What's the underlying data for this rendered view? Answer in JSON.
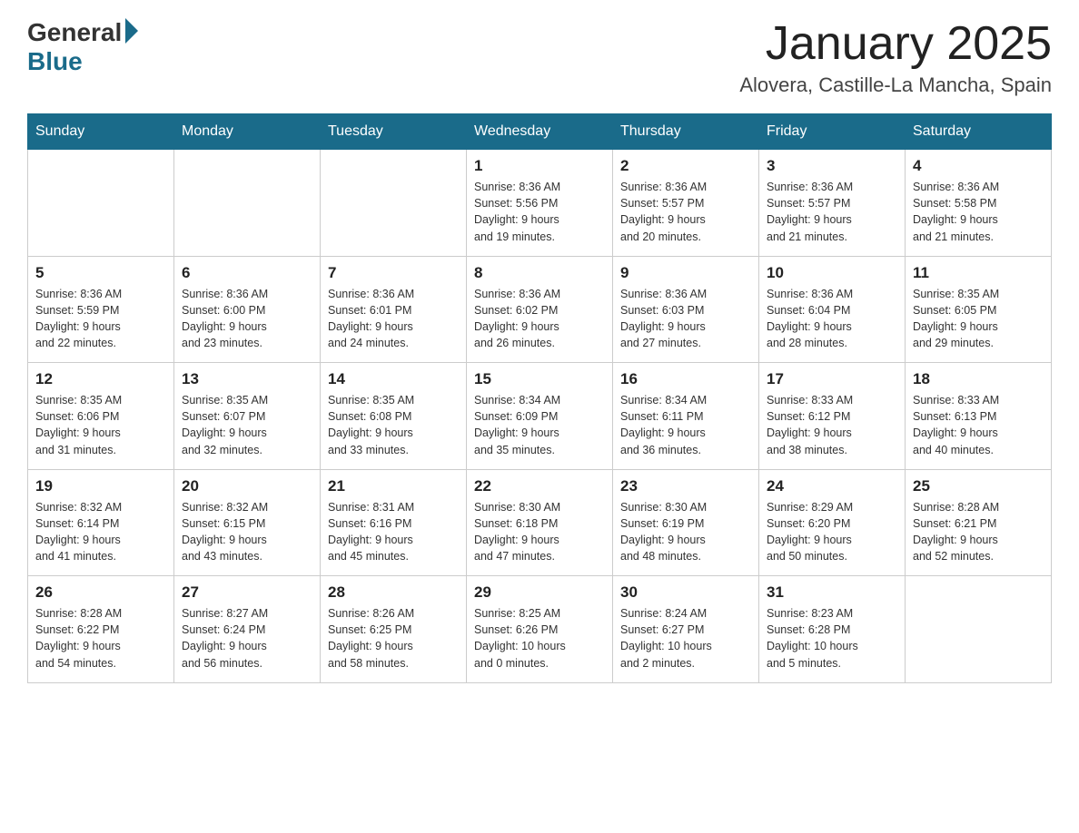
{
  "header": {
    "logo_general": "General",
    "logo_blue": "Blue",
    "month_year": "January 2025",
    "location": "Alovera, Castille-La Mancha, Spain"
  },
  "days_of_week": [
    "Sunday",
    "Monday",
    "Tuesday",
    "Wednesday",
    "Thursday",
    "Friday",
    "Saturday"
  ],
  "weeks": [
    [
      {
        "day": "",
        "info": ""
      },
      {
        "day": "",
        "info": ""
      },
      {
        "day": "",
        "info": ""
      },
      {
        "day": "1",
        "info": "Sunrise: 8:36 AM\nSunset: 5:56 PM\nDaylight: 9 hours\nand 19 minutes."
      },
      {
        "day": "2",
        "info": "Sunrise: 8:36 AM\nSunset: 5:57 PM\nDaylight: 9 hours\nand 20 minutes."
      },
      {
        "day": "3",
        "info": "Sunrise: 8:36 AM\nSunset: 5:57 PM\nDaylight: 9 hours\nand 21 minutes."
      },
      {
        "day": "4",
        "info": "Sunrise: 8:36 AM\nSunset: 5:58 PM\nDaylight: 9 hours\nand 21 minutes."
      }
    ],
    [
      {
        "day": "5",
        "info": "Sunrise: 8:36 AM\nSunset: 5:59 PM\nDaylight: 9 hours\nand 22 minutes."
      },
      {
        "day": "6",
        "info": "Sunrise: 8:36 AM\nSunset: 6:00 PM\nDaylight: 9 hours\nand 23 minutes."
      },
      {
        "day": "7",
        "info": "Sunrise: 8:36 AM\nSunset: 6:01 PM\nDaylight: 9 hours\nand 24 minutes."
      },
      {
        "day": "8",
        "info": "Sunrise: 8:36 AM\nSunset: 6:02 PM\nDaylight: 9 hours\nand 26 minutes."
      },
      {
        "day": "9",
        "info": "Sunrise: 8:36 AM\nSunset: 6:03 PM\nDaylight: 9 hours\nand 27 minutes."
      },
      {
        "day": "10",
        "info": "Sunrise: 8:36 AM\nSunset: 6:04 PM\nDaylight: 9 hours\nand 28 minutes."
      },
      {
        "day": "11",
        "info": "Sunrise: 8:35 AM\nSunset: 6:05 PM\nDaylight: 9 hours\nand 29 minutes."
      }
    ],
    [
      {
        "day": "12",
        "info": "Sunrise: 8:35 AM\nSunset: 6:06 PM\nDaylight: 9 hours\nand 31 minutes."
      },
      {
        "day": "13",
        "info": "Sunrise: 8:35 AM\nSunset: 6:07 PM\nDaylight: 9 hours\nand 32 minutes."
      },
      {
        "day": "14",
        "info": "Sunrise: 8:35 AM\nSunset: 6:08 PM\nDaylight: 9 hours\nand 33 minutes."
      },
      {
        "day": "15",
        "info": "Sunrise: 8:34 AM\nSunset: 6:09 PM\nDaylight: 9 hours\nand 35 minutes."
      },
      {
        "day": "16",
        "info": "Sunrise: 8:34 AM\nSunset: 6:11 PM\nDaylight: 9 hours\nand 36 minutes."
      },
      {
        "day": "17",
        "info": "Sunrise: 8:33 AM\nSunset: 6:12 PM\nDaylight: 9 hours\nand 38 minutes."
      },
      {
        "day": "18",
        "info": "Sunrise: 8:33 AM\nSunset: 6:13 PM\nDaylight: 9 hours\nand 40 minutes."
      }
    ],
    [
      {
        "day": "19",
        "info": "Sunrise: 8:32 AM\nSunset: 6:14 PM\nDaylight: 9 hours\nand 41 minutes."
      },
      {
        "day": "20",
        "info": "Sunrise: 8:32 AM\nSunset: 6:15 PM\nDaylight: 9 hours\nand 43 minutes."
      },
      {
        "day": "21",
        "info": "Sunrise: 8:31 AM\nSunset: 6:16 PM\nDaylight: 9 hours\nand 45 minutes."
      },
      {
        "day": "22",
        "info": "Sunrise: 8:30 AM\nSunset: 6:18 PM\nDaylight: 9 hours\nand 47 minutes."
      },
      {
        "day": "23",
        "info": "Sunrise: 8:30 AM\nSunset: 6:19 PM\nDaylight: 9 hours\nand 48 minutes."
      },
      {
        "day": "24",
        "info": "Sunrise: 8:29 AM\nSunset: 6:20 PM\nDaylight: 9 hours\nand 50 minutes."
      },
      {
        "day": "25",
        "info": "Sunrise: 8:28 AM\nSunset: 6:21 PM\nDaylight: 9 hours\nand 52 minutes."
      }
    ],
    [
      {
        "day": "26",
        "info": "Sunrise: 8:28 AM\nSunset: 6:22 PM\nDaylight: 9 hours\nand 54 minutes."
      },
      {
        "day": "27",
        "info": "Sunrise: 8:27 AM\nSunset: 6:24 PM\nDaylight: 9 hours\nand 56 minutes."
      },
      {
        "day": "28",
        "info": "Sunrise: 8:26 AM\nSunset: 6:25 PM\nDaylight: 9 hours\nand 58 minutes."
      },
      {
        "day": "29",
        "info": "Sunrise: 8:25 AM\nSunset: 6:26 PM\nDaylight: 10 hours\nand 0 minutes."
      },
      {
        "day": "30",
        "info": "Sunrise: 8:24 AM\nSunset: 6:27 PM\nDaylight: 10 hours\nand 2 minutes."
      },
      {
        "day": "31",
        "info": "Sunrise: 8:23 AM\nSunset: 6:28 PM\nDaylight: 10 hours\nand 5 minutes."
      },
      {
        "day": "",
        "info": ""
      }
    ]
  ]
}
